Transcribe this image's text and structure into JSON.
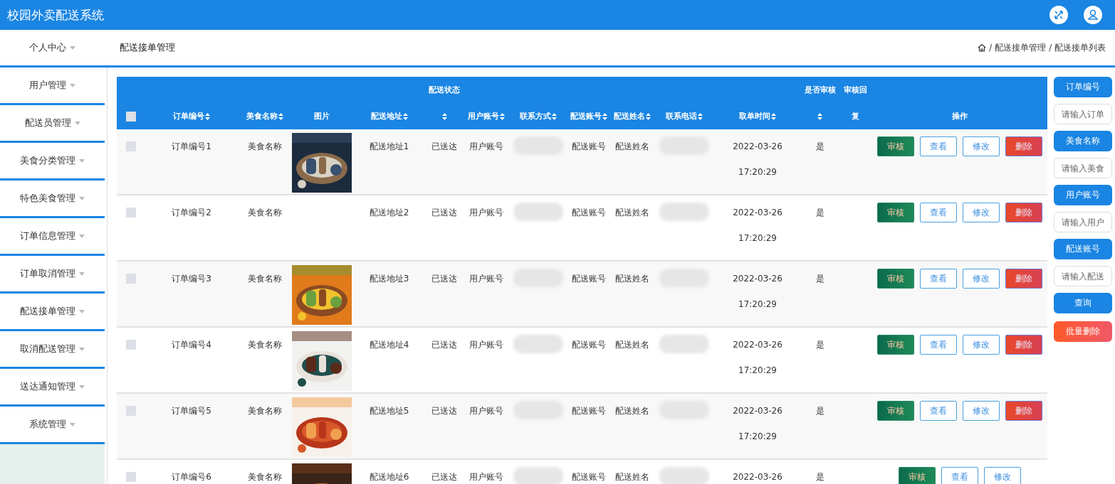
{
  "header": {
    "title": "校园外卖配送系统"
  },
  "sidebar": {
    "items": [
      {
        "label": "个人中心"
      },
      {
        "label": "用户管理"
      },
      {
        "label": "配送员管理"
      },
      {
        "label": "美食分类管理"
      },
      {
        "label": "特色美食管理"
      },
      {
        "label": "订单信息管理"
      },
      {
        "label": "订单取消管理"
      },
      {
        "label": "配送接单管理"
      },
      {
        "label": "取消配送管理"
      },
      {
        "label": "送达通知管理"
      },
      {
        "label": "系统管理"
      }
    ]
  },
  "page_title": "配送接单管理",
  "breadcrumb": {
    "separator": "/",
    "items": [
      "配送接单管理",
      "配送接单列表"
    ]
  },
  "table": {
    "columns": [
      {
        "kind": "checkbox",
        "checked": false
      },
      {
        "label": "订单编号",
        "sortable": true
      },
      {
        "label": "美食名称",
        "sortable": true
      },
      {
        "label": "图片",
        "sortable": false
      },
      {
        "label": "配送地址",
        "sortable": true
      },
      {
        "top": "配送状态",
        "sortable": true
      },
      {
        "label": "用户账号",
        "sortable": true
      },
      {
        "label": "联系方式",
        "sortable": true
      },
      {
        "label": "配送账号",
        "sortable": true
      },
      {
        "label": "配送姓名",
        "sortable": true
      },
      {
        "label": "联系电话",
        "sortable": true
      },
      {
        "label": "取单时间",
        "sortable": true
      },
      {
        "top": "是否审核",
        "sortable": true
      },
      {
        "top": "审核回",
        "label": "复",
        "sortable": false
      },
      {
        "label": "操作",
        "sortable": false
      }
    ],
    "rows": [
      {
        "cells": [
          {
            "kind": "checkbox",
            "checked": false
          },
          {
            "kind": "text",
            "text": "订单编号1"
          },
          {
            "kind": "text",
            "text": "美食名称"
          },
          {
            "kind": "picture"
          },
          {
            "kind": "text",
            "text": "配送地址1"
          },
          {
            "kind": "text",
            "text": "已送达"
          },
          {
            "kind": "text",
            "text": "用户账号"
          },
          {
            "kind": "blurred"
          },
          {
            "kind": "text",
            "text": "配送账号"
          },
          {
            "kind": "text",
            "text": "配送姓名"
          },
          {
            "kind": "blurred"
          },
          {
            "kind": "text",
            "text": "2022-03-26 17:20:29"
          },
          {
            "kind": "text",
            "text": "是"
          },
          {
            "kind": "blank"
          },
          {
            "kind": "actions",
            "buttons": [
              {
                "kind": "review",
                "label": "审核"
              },
              {
                "kind": "outline",
                "label": "查看"
              },
              {
                "kind": "outline",
                "label": "修改"
              },
              {
                "kind": "delete",
                "label": "删除"
              }
            ]
          }
        ]
      },
      {
        "cells": [
          {
            "kind": "checkbox",
            "checked": false
          },
          {
            "kind": "text",
            "text": "订单编号2"
          },
          {
            "kind": "text",
            "text": "美食名称"
          },
          {
            "kind": "blank"
          },
          {
            "kind": "text",
            "text": "配送地址2"
          },
          {
            "kind": "text",
            "text": "已送达"
          },
          {
            "kind": "text",
            "text": "用户账号"
          },
          {
            "kind": "blurred"
          },
          {
            "kind": "text",
            "text": "配送账号"
          },
          {
            "kind": "text",
            "text": "配送姓名"
          },
          {
            "kind": "blurred"
          },
          {
            "kind": "text",
            "text": "2022-03-26 17:20:29"
          },
          {
            "kind": "text",
            "text": "是"
          },
          {
            "kind": "blank"
          },
          {
            "kind": "actions",
            "buttons": [
              {
                "kind": "review",
                "label": "审核"
              },
              {
                "kind": "outline",
                "label": "查看"
              },
              {
                "kind": "outline",
                "label": "修改"
              },
              {
                "kind": "delete",
                "label": "删除"
              }
            ]
          }
        ]
      },
      {
        "cells": [
          {
            "kind": "checkbox",
            "checked": false
          },
          {
            "kind": "text",
            "text": "订单编号3"
          },
          {
            "kind": "text",
            "text": "美食名称"
          },
          {
            "kind": "picture"
          },
          {
            "kind": "text",
            "text": "配送地址3"
          },
          {
            "kind": "text",
            "text": "已送达"
          },
          {
            "kind": "text",
            "text": "用户账号"
          },
          {
            "kind": "blurred"
          },
          {
            "kind": "text",
            "text": "配送账号"
          },
          {
            "kind": "text",
            "text": "配送姓名"
          },
          {
            "kind": "blurred"
          },
          {
            "kind": "text",
            "text": "2022-03-26 17:20:29"
          },
          {
            "kind": "text",
            "text": "是"
          },
          {
            "kind": "blank"
          },
          {
            "kind": "actions",
            "buttons": [
              {
                "kind": "review",
                "label": "审核"
              },
              {
                "kind": "outline",
                "label": "查看"
              },
              {
                "kind": "outline",
                "label": "修改"
              },
              {
                "kind": "delete",
                "label": "删除"
              }
            ]
          }
        ]
      },
      {
        "cells": [
          {
            "kind": "checkbox",
            "checked": false
          },
          {
            "kind": "text",
            "text": "订单编号4"
          },
          {
            "kind": "text",
            "text": "美食名称"
          },
          {
            "kind": "picture"
          },
          {
            "kind": "text",
            "text": "配送地址4"
          },
          {
            "kind": "text",
            "text": "已送达"
          },
          {
            "kind": "text",
            "text": "用户账号"
          },
          {
            "kind": "blurred"
          },
          {
            "kind": "text",
            "text": "配送账号"
          },
          {
            "kind": "text",
            "text": "配送姓名"
          },
          {
            "kind": "blurred"
          },
          {
            "kind": "text",
            "text": "2022-03-26 17:20:29"
          },
          {
            "kind": "text",
            "text": "是"
          },
          {
            "kind": "blank"
          },
          {
            "kind": "actions",
            "buttons": [
              {
                "kind": "review",
                "label": "审核"
              },
              {
                "kind": "outline",
                "label": "查看"
              },
              {
                "kind": "outline",
                "label": "修改"
              },
              {
                "kind": "delete",
                "label": "删除"
              }
            ]
          }
        ]
      },
      {
        "cells": [
          {
            "kind": "checkbox",
            "checked": false
          },
          {
            "kind": "text",
            "text": "订单编号5"
          },
          {
            "kind": "text",
            "text": "美食名称"
          },
          {
            "kind": "picture"
          },
          {
            "kind": "text",
            "text": "配送地址5"
          },
          {
            "kind": "text",
            "text": "已送达"
          },
          {
            "kind": "text",
            "text": "用户账号"
          },
          {
            "kind": "blurred"
          },
          {
            "kind": "text",
            "text": "配送账号"
          },
          {
            "kind": "text",
            "text": "配送姓名"
          },
          {
            "kind": "blurred"
          },
          {
            "kind": "text",
            "text": "2022-03-26 17:20:29"
          },
          {
            "kind": "text",
            "text": "是"
          },
          {
            "kind": "blank"
          },
          {
            "kind": "actions",
            "buttons": [
              {
                "kind": "review",
                "label": "审核"
              },
              {
                "kind": "outline",
                "label": "查看"
              },
              {
                "kind": "outline",
                "label": "修改"
              },
              {
                "kind": "delete",
                "label": "删除"
              }
            ]
          }
        ]
      },
      {
        "cells": [
          {
            "kind": "checkbox",
            "checked": false
          },
          {
            "kind": "text",
            "text": "订单编号6"
          },
          {
            "kind": "text",
            "text": "美食名称"
          },
          {
            "kind": "picture"
          },
          {
            "kind": "text",
            "text": "配送地址6"
          },
          {
            "kind": "text",
            "text": "已送达"
          },
          {
            "kind": "text",
            "text": "用户账号"
          },
          {
            "kind": "blurred"
          },
          {
            "kind": "text",
            "text": "配送账号"
          },
          {
            "kind": "text",
            "text": "配送姓名"
          },
          {
            "kind": "blurred"
          },
          {
            "kind": "text",
            "text": "2022-03-26"
          },
          {
            "kind": "text",
            "text": "是"
          },
          {
            "kind": "blank"
          },
          {
            "kind": "actions",
            "buttons": [
              {
                "kind": "review",
                "label": "审核"
              },
              {
                "kind": "outline",
                "label": "查看"
              },
              {
                "kind": "outline",
                "label": "修改"
              }
            ]
          }
        ]
      }
    ]
  },
  "search_panel": {
    "fields": [
      {
        "label": "订单编号",
        "placeholder": "请输入订单"
      },
      {
        "label": "美食名称",
        "placeholder": "请输入美食"
      },
      {
        "label": "用户账号",
        "placeholder": "请输入用户"
      },
      {
        "label": "配送账号",
        "placeholder": "请输入配送"
      }
    ],
    "buttons": [
      {
        "kind": "search",
        "label": "查询"
      },
      {
        "kind": "batch_delete",
        "label": "批量删除"
      }
    ]
  }
}
